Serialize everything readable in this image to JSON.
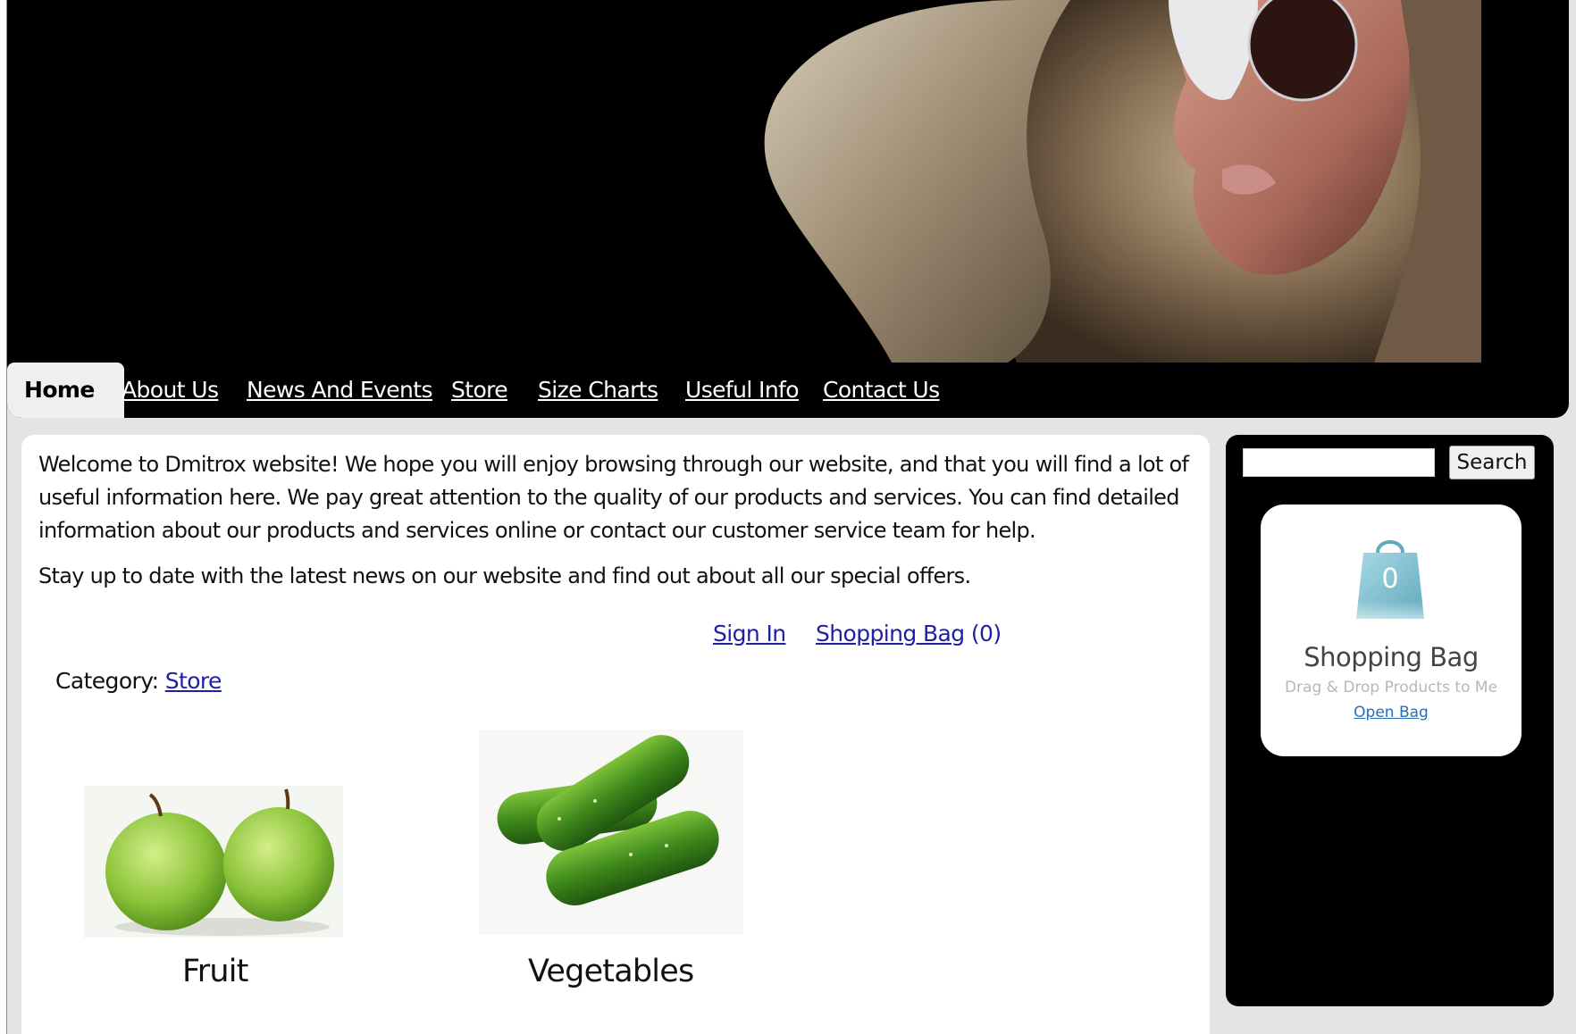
{
  "nav": {
    "items": [
      {
        "label": "Home"
      },
      {
        "label": "About Us"
      },
      {
        "label": "News And Events"
      },
      {
        "label": "Store"
      },
      {
        "label": "Size Charts"
      },
      {
        "label": "Useful Info"
      },
      {
        "label": "Contact Us"
      }
    ]
  },
  "content": {
    "paragraph_1": "Welcome to Dmitrox website! We hope you will enjoy browsing through our website, and that you will find a lot of useful information here. We pay great attention to the quality of our products and services. You can find detailed information about our products and services online or contact our customer service team for help.",
    "paragraph_2": "Stay up to date with the latest news on our website and find out about all our special offers.",
    "sign_in": "Sign In",
    "shopping_bag_link": "Shopping Bag",
    "shopping_bag_count": "(0)",
    "category_label": "Category:",
    "category_link": "Store",
    "products": [
      {
        "label": "Fruit"
      },
      {
        "label": "Vegetables"
      }
    ]
  },
  "sidebar": {
    "search_placeholder": "",
    "search_button": "Search",
    "bag": {
      "count": "0",
      "title": "Shopping Bag",
      "subtitle": "Drag & Drop Products to Me",
      "open_link": "Open Bag"
    }
  },
  "colors": {
    "header_bg": "#000000",
    "page_bg": "#e4e4e4",
    "link": "#1f1fa8",
    "bag_link": "#2a6db6",
    "bag_icon": "#8fc7d6"
  },
  "icons": {
    "banner": "fashion-model-banner-image",
    "shopping_bag": "shopping-bag-icon",
    "fruit": "green-apples-image",
    "vegetables": "cucumbers-image"
  }
}
